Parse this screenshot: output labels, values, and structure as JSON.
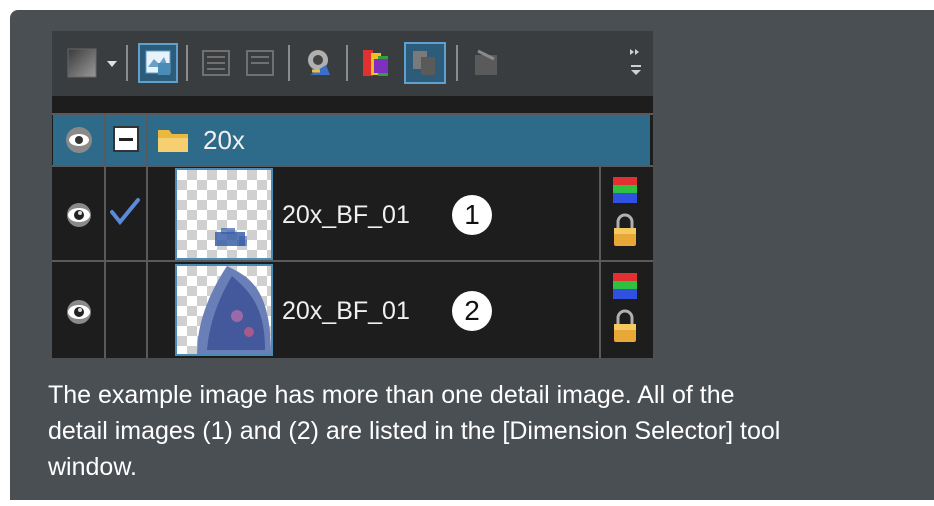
{
  "dimension_selector": {
    "toolbar": {
      "buttons": [
        {
          "name": "color-picker-icon"
        },
        {
          "name": "dropdown-arrow-icon"
        },
        {
          "name": "image-properties-icon"
        },
        {
          "name": "merge-layers-icon"
        },
        {
          "name": "split-layers-icon"
        },
        {
          "name": "channel-mix-icon"
        },
        {
          "name": "color-channels-icon"
        },
        {
          "name": "overlay-icon"
        },
        {
          "name": "delete-icon"
        },
        {
          "name": "overflow-icon"
        }
      ]
    },
    "folder": {
      "label": "20x"
    },
    "layers": [
      {
        "label": "20x_BF_01",
        "badge": "1",
        "checked": true
      },
      {
        "label": "20x_BF_01",
        "badge": "2",
        "checked": false
      }
    ]
  },
  "caption": {
    "line1": "The example image has more than one detail image. All of the",
    "line2_pre": "detail images ",
    "ref1": "(1)",
    "and": " and ",
    "ref2": "(2)",
    "line2_post": " are listed in the [Dimension Selector] tool",
    "line3": "window."
  },
  "colors": {
    "card_bg": "#4a4f54",
    "folder_row": "#2e6a8a",
    "panel_bg": "#1d1d1d",
    "accent": "#4b8bb7"
  }
}
